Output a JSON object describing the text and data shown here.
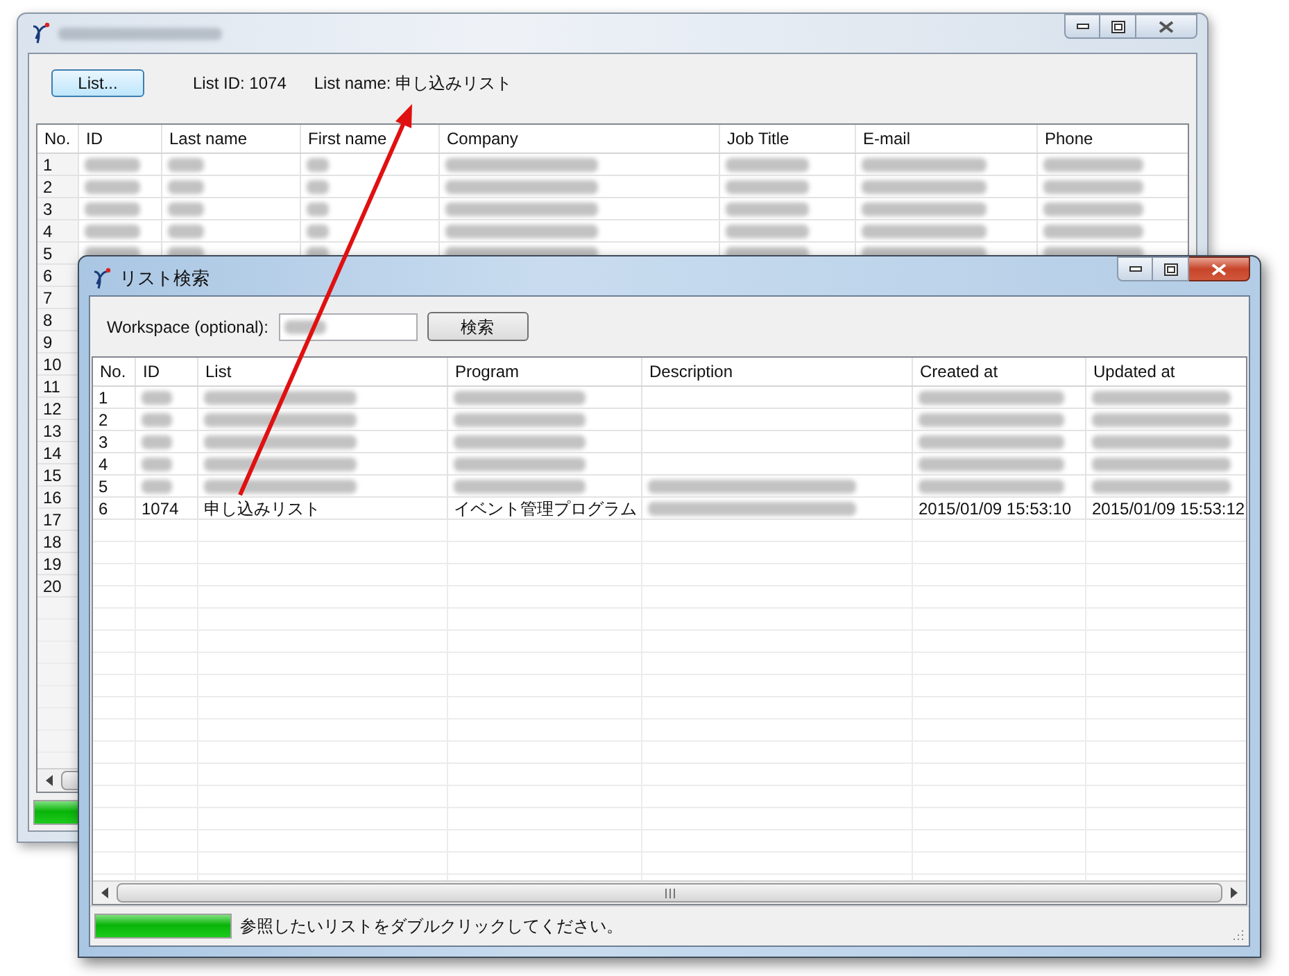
{
  "main_window": {
    "list_button": "List...",
    "list_id": "List ID: 1074",
    "list_name": "List name: 申し込みリスト",
    "table": {
      "columns": [
        "No.",
        "ID",
        "Last name",
        "First name",
        "Company",
        "Job Title",
        "E-mail",
        "Phone"
      ],
      "rows": [
        {
          "cells": [
            "1",
            {
              "kind": "blurred"
            },
            {
              "kind": "blurred"
            },
            {
              "kind": "blurred"
            },
            {
              "kind": "blurred"
            },
            {
              "kind": "blurred"
            },
            {
              "kind": "blurred"
            },
            {
              "kind": "blurred"
            }
          ]
        },
        {
          "cells": [
            "2",
            {
              "kind": "blurred"
            },
            {
              "kind": "blurred"
            },
            {
              "kind": "blurred"
            },
            {
              "kind": "blurred"
            },
            {
              "kind": "blurred"
            },
            {
              "kind": "blurred"
            },
            {
              "kind": "blurred"
            }
          ]
        },
        {
          "cells": [
            "3",
            {
              "kind": "blurred"
            },
            {
              "kind": "blurred"
            },
            {
              "kind": "blurred"
            },
            {
              "kind": "blurred"
            },
            {
              "kind": "blurred"
            },
            {
              "kind": "blurred"
            },
            {
              "kind": "blurred"
            }
          ]
        },
        {
          "cells": [
            "4",
            {
              "kind": "blurred"
            },
            {
              "kind": "blurred"
            },
            {
              "kind": "blurred"
            },
            {
              "kind": "blurred"
            },
            {
              "kind": "blurred"
            },
            {
              "kind": "blurred"
            },
            {
              "kind": "blurred"
            }
          ]
        },
        {
          "cells": [
            "5",
            {
              "kind": "blurred"
            },
            {
              "kind": "blurred"
            },
            {
              "kind": "blurred"
            },
            {
              "kind": "blurred"
            },
            {
              "kind": "blurred"
            },
            {
              "kind": "blurred"
            },
            {
              "kind": "blurred"
            }
          ]
        },
        {
          "cells": [
            "6"
          ]
        },
        {
          "cells": [
            "7"
          ]
        },
        {
          "cells": [
            "8"
          ]
        },
        {
          "cells": [
            "9"
          ]
        },
        {
          "cells": [
            "10"
          ]
        },
        {
          "cells": [
            "11"
          ]
        },
        {
          "cells": [
            "12"
          ]
        },
        {
          "cells": [
            "13"
          ]
        },
        {
          "cells": [
            "14"
          ]
        },
        {
          "cells": [
            "15"
          ]
        },
        {
          "cells": [
            "16"
          ]
        },
        {
          "cells": [
            "17"
          ]
        },
        {
          "cells": [
            "18"
          ]
        },
        {
          "cells": [
            "19"
          ]
        },
        {
          "cells": [
            "20"
          ]
        }
      ]
    },
    "status_bar": {
      "level": 1
    }
  },
  "dialog": {
    "title": "リスト検索",
    "workspace_label": "Workspace (optional):",
    "workspace_field": {
      "kind": "blurred"
    },
    "search_button": "検索",
    "table": {
      "columns": [
        "No.",
        "ID",
        "List",
        "Program",
        "Description",
        "Created at",
        "Updated at"
      ],
      "rows": [
        {
          "cells": [
            "1",
            {
              "kind": "blurred"
            },
            {
              "kind": "blurred"
            },
            {
              "kind": "blurred"
            },
            null,
            {
              "kind": "blurred"
            },
            {
              "kind": "blurred"
            }
          ]
        },
        {
          "cells": [
            "2",
            {
              "kind": "blurred"
            },
            {
              "kind": "blurred"
            },
            {
              "kind": "blurred"
            },
            null,
            {
              "kind": "blurred"
            },
            {
              "kind": "blurred"
            }
          ]
        },
        {
          "cells": [
            "3",
            {
              "kind": "blurred"
            },
            {
              "kind": "blurred"
            },
            {
              "kind": "blurred"
            },
            null,
            {
              "kind": "blurred"
            },
            {
              "kind": "blurred"
            }
          ]
        },
        {
          "cells": [
            "4",
            {
              "kind": "blurred"
            },
            {
              "kind": "blurred"
            },
            {
              "kind": "blurred"
            },
            null,
            {
              "kind": "blurred"
            },
            {
              "kind": "blurred"
            }
          ]
        },
        {
          "cells": [
            "5",
            {
              "kind": "blurred"
            },
            {
              "kind": "blurred"
            },
            {
              "kind": "blurred"
            },
            {
              "kind": "blurred"
            },
            {
              "kind": "blurred"
            },
            {
              "kind": "blurred"
            }
          ]
        },
        {
          "cells": [
            "6",
            "1074",
            "申し込みリスト",
            "イベント管理プログラム",
            {
              "kind": "blurred"
            },
            "2015/01/09 15:53:10",
            "2015/01/09 15:53:12"
          ]
        }
      ]
    },
    "status_bar": {
      "level": 1,
      "text": "参照したいリストをダブルクリックしてください。"
    }
  }
}
